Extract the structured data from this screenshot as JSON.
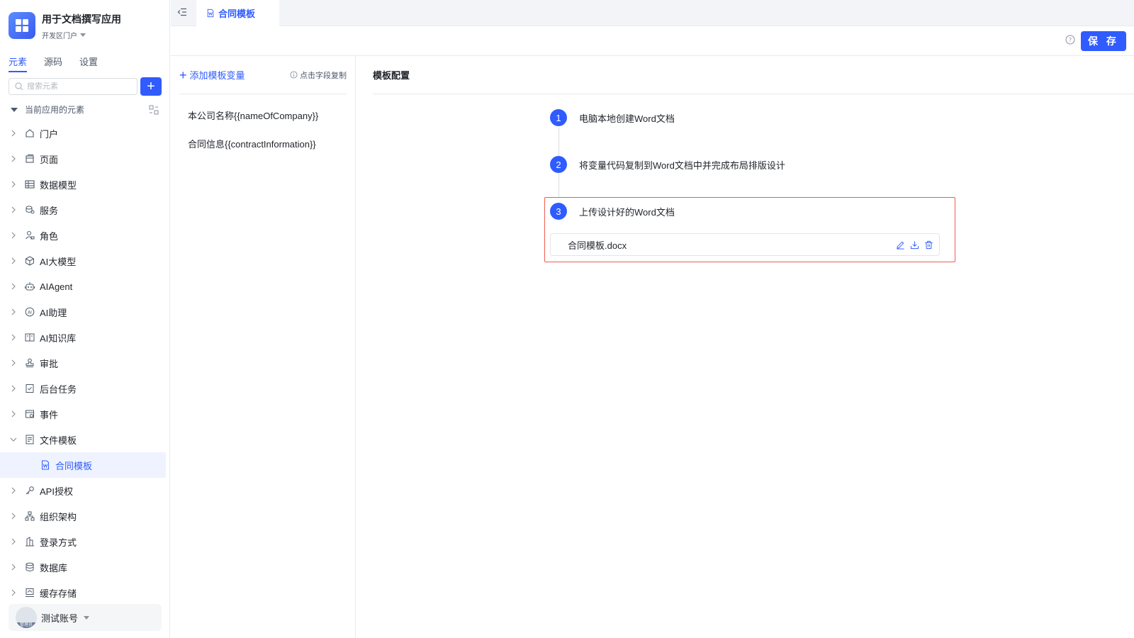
{
  "app": {
    "title": "用于文档撰写应用",
    "portal": "开发区门户"
  },
  "sidebar": {
    "tabs": [
      {
        "label": "元素"
      },
      {
        "label": "源码"
      },
      {
        "label": "设置"
      }
    ],
    "search_placeholder": "搜索元素",
    "tree_title": "当前应用的元素",
    "items": [
      {
        "label": "门户",
        "icon": "home-icon"
      },
      {
        "label": "页面",
        "icon": "page-icon"
      },
      {
        "label": "数据模型",
        "icon": "table-icon"
      },
      {
        "label": "服务",
        "icon": "service-icon"
      },
      {
        "label": "角色",
        "icon": "role-icon"
      },
      {
        "label": "AI大模型",
        "icon": "cube-icon"
      },
      {
        "label": "AIAgent",
        "icon": "robot-icon"
      },
      {
        "label": "AI助理",
        "icon": "ai-icon"
      },
      {
        "label": "AI知识库",
        "icon": "book-icon"
      },
      {
        "label": "审批",
        "icon": "stamp-icon"
      },
      {
        "label": "后台任务",
        "icon": "task-icon"
      },
      {
        "label": "事件",
        "icon": "event-icon"
      },
      {
        "label": "文件模板",
        "icon": "file-template-icon"
      },
      {
        "label": "合同模板",
        "icon": "word-file-icon"
      },
      {
        "label": "API授权",
        "icon": "key-icon"
      },
      {
        "label": "组织架构",
        "icon": "org-icon"
      },
      {
        "label": "登录方式",
        "icon": "login-icon"
      },
      {
        "label": "数据库",
        "icon": "database-icon"
      },
      {
        "label": "缓存存储",
        "icon": "cache-icon"
      }
    ],
    "account": {
      "name": "测试账号",
      "role_badge": "管理员"
    }
  },
  "tabs": {
    "active": "合同模板"
  },
  "toolbar": {
    "save_label": "保 存"
  },
  "variables": {
    "add_label": "添加模板变量",
    "copy_hint": "点击字段复制",
    "items": [
      "本公司名称{{nameOfCompany}}",
      "合同信息{{contractInformation}}"
    ]
  },
  "config": {
    "title": "模板配置",
    "steps": [
      {
        "num": "1",
        "text": "电脑本地创建Word文档"
      },
      {
        "num": "2",
        "text": "将变量代码复制到Word文档中并完成布局排版设计"
      },
      {
        "num": "3",
        "text": "上传设计好的Word文档"
      }
    ],
    "file_name": "合同模板.docx"
  },
  "colors": {
    "accent": "#2f5bff",
    "highlight": "#f05a4f",
    "selected_bg": "#eef3ff"
  }
}
